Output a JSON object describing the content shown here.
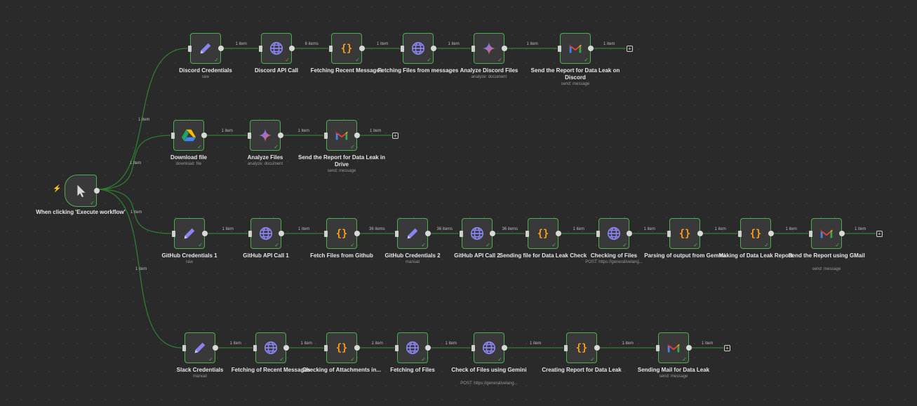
{
  "theme": {
    "accent": "#4caf50",
    "wire": "#2e7d32",
    "background": "#2a2a2a",
    "node": "#393939"
  },
  "trigger": {
    "label": "When clicking 'Execute workflow'",
    "icon": "pointer-icon"
  },
  "branches": [
    {
      "trigger_edge": "1 item",
      "nodes": [
        {
          "name": "Discord Credentials",
          "sub": "raw",
          "icon": "pencil"
        },
        {
          "name": "Discord API Call",
          "sub": "",
          "icon": "globe"
        },
        {
          "name": "Fetching Recent Messages",
          "sub": "",
          "icon": "code"
        },
        {
          "name": "Fetching Files from messages",
          "sub": "",
          "icon": "globe"
        },
        {
          "name": "Analyze Discord Files",
          "sub": "analyze: document",
          "icon": "gemini"
        },
        {
          "name": "Send the Report for Data Leak on Discord",
          "sub": "send: message",
          "icon": "gmail"
        }
      ],
      "edges": [
        "1 item",
        "6 items",
        "1 item",
        "1 item",
        "1 item",
        "1 item"
      ]
    },
    {
      "trigger_edge": "1 item",
      "nodes": [
        {
          "name": "Download file",
          "sub": "download: file",
          "icon": "drive"
        },
        {
          "name": "Analyze Files",
          "sub": "analyze: document",
          "icon": "gemini"
        },
        {
          "name": "Send the Report for Data Leak in Drive",
          "sub": "send: message",
          "icon": "gmail"
        }
      ],
      "edges": [
        "1 item",
        "1 item",
        "1 item"
      ]
    },
    {
      "trigger_edge": "1 item",
      "nodes": [
        {
          "name": "GitHub Credentials 1",
          "sub": "raw",
          "icon": "pencil"
        },
        {
          "name": "GitHub API Call 1",
          "sub": "",
          "icon": "globe"
        },
        {
          "name": "Fetch Files from Github",
          "sub": "",
          "icon": "code"
        },
        {
          "name": "GitHub Credentials 2",
          "sub": "manual",
          "icon": "pencil"
        },
        {
          "name": "GitHub API Call 2",
          "sub": "",
          "icon": "globe"
        },
        {
          "name": "Sending file for Data Leak Check",
          "sub": "",
          "icon": "code"
        },
        {
          "name": "Checking of Files",
          "sub": "POST: https://generativelang...",
          "icon": "globe"
        },
        {
          "name": "Parsing of output from Gemini",
          "sub": "",
          "icon": "code"
        },
        {
          "name": "Making of Data Leak Report",
          "sub": "",
          "icon": "code"
        },
        {
          "name": "Send the Report using GMail",
          "sub": "send: message",
          "icon": "gmail"
        }
      ],
      "edges": [
        "1 item",
        "1 item",
        "36 items",
        "36 items",
        "36 items",
        "1 item",
        "1 item",
        "1 item",
        "1 item",
        "1 item"
      ]
    },
    {
      "trigger_edge": "1 item",
      "nodes": [
        {
          "name": "Slack Credentials",
          "sub": "manual",
          "icon": "pencil"
        },
        {
          "name": "Fetching of Recent Messages",
          "sub": "",
          "icon": "globe"
        },
        {
          "name": "Checking of Attachments in...",
          "sub": "",
          "icon": "code"
        },
        {
          "name": "Fetching of Files",
          "sub": "",
          "icon": "globe"
        },
        {
          "name": "Check of Files using Gemini",
          "sub": "POST: https://generativelang...",
          "icon": "globe"
        },
        {
          "name": "Creating Report for Data Leak",
          "sub": "",
          "icon": "code"
        },
        {
          "name": "Sending Mail for Data Leak",
          "sub": "send: message",
          "icon": "gmail"
        }
      ],
      "edges": [
        "1 item",
        "1 item",
        "1 item",
        "1 item",
        "1 item",
        "1 item",
        "1 item"
      ]
    }
  ]
}
